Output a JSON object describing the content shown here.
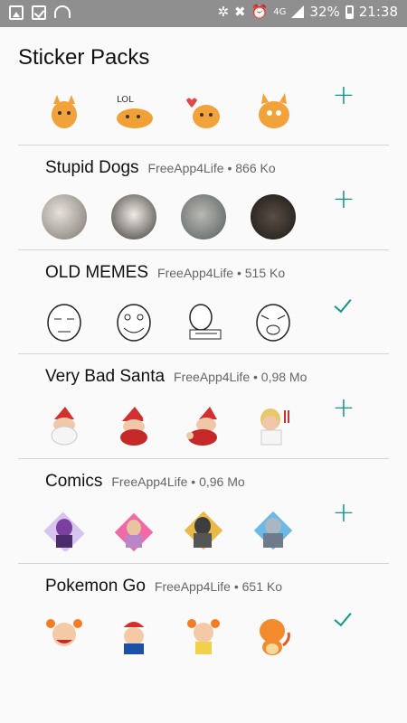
{
  "status_bar": {
    "network": "4G",
    "battery_percent": "32%",
    "time": "21:38",
    "icons": [
      "gallery-icon",
      "checkbox-icon",
      "wifi-icon",
      "bluetooth-icon",
      "mute-icon",
      "alarm-icon",
      "signal-icon",
      "battery-icon"
    ]
  },
  "page": {
    "title": "Sticker Packs"
  },
  "packs": [
    {
      "name": "",
      "meta": "",
      "action": "add",
      "stickers": [
        "cat-sticker",
        "cat-lol-sticker",
        "cat-heart-sticker",
        "cat-scared-sticker"
      ]
    },
    {
      "name": "Stupid Dogs",
      "meta": "FreeApp4Life • 866 Ko",
      "action": "add",
      "stickers": [
        "dog-sticker",
        "dog-sticker",
        "dog-sticker",
        "dog-sticker"
      ]
    },
    {
      "name": "OLD MEMES",
      "meta": "FreeApp4Life • 515 Ko",
      "action": "added",
      "stickers": [
        "meme-sticker",
        "meme-sticker",
        "meme-sticker",
        "meme-sticker"
      ]
    },
    {
      "name": "Very Bad Santa",
      "meta": "FreeApp4Life • 0,98 Mo",
      "action": "add",
      "stickers": [
        "santa-sticker",
        "santa-sticker",
        "santa-sticker",
        "santa-sticker"
      ]
    },
    {
      "name": "Comics",
      "meta": "FreeApp4Life • 0,96 Mo",
      "action": "add",
      "stickers": [
        "comics-sticker",
        "comics-sticker",
        "comics-sticker",
        "comics-sticker"
      ]
    },
    {
      "name": "Pokemon Go",
      "meta": "FreeApp4Life • 651 Ko",
      "action": "added",
      "stickers": [
        "pokemon-sticker",
        "pokemon-sticker",
        "pokemon-sticker",
        "pokemon-sticker"
      ]
    }
  ],
  "colors": {
    "accent": "#119688",
    "status_bar": "#8f8f8f",
    "divider": "#d6d6d6"
  },
  "action_icons": {
    "add": "plus-icon",
    "added": "checkmark-icon"
  }
}
